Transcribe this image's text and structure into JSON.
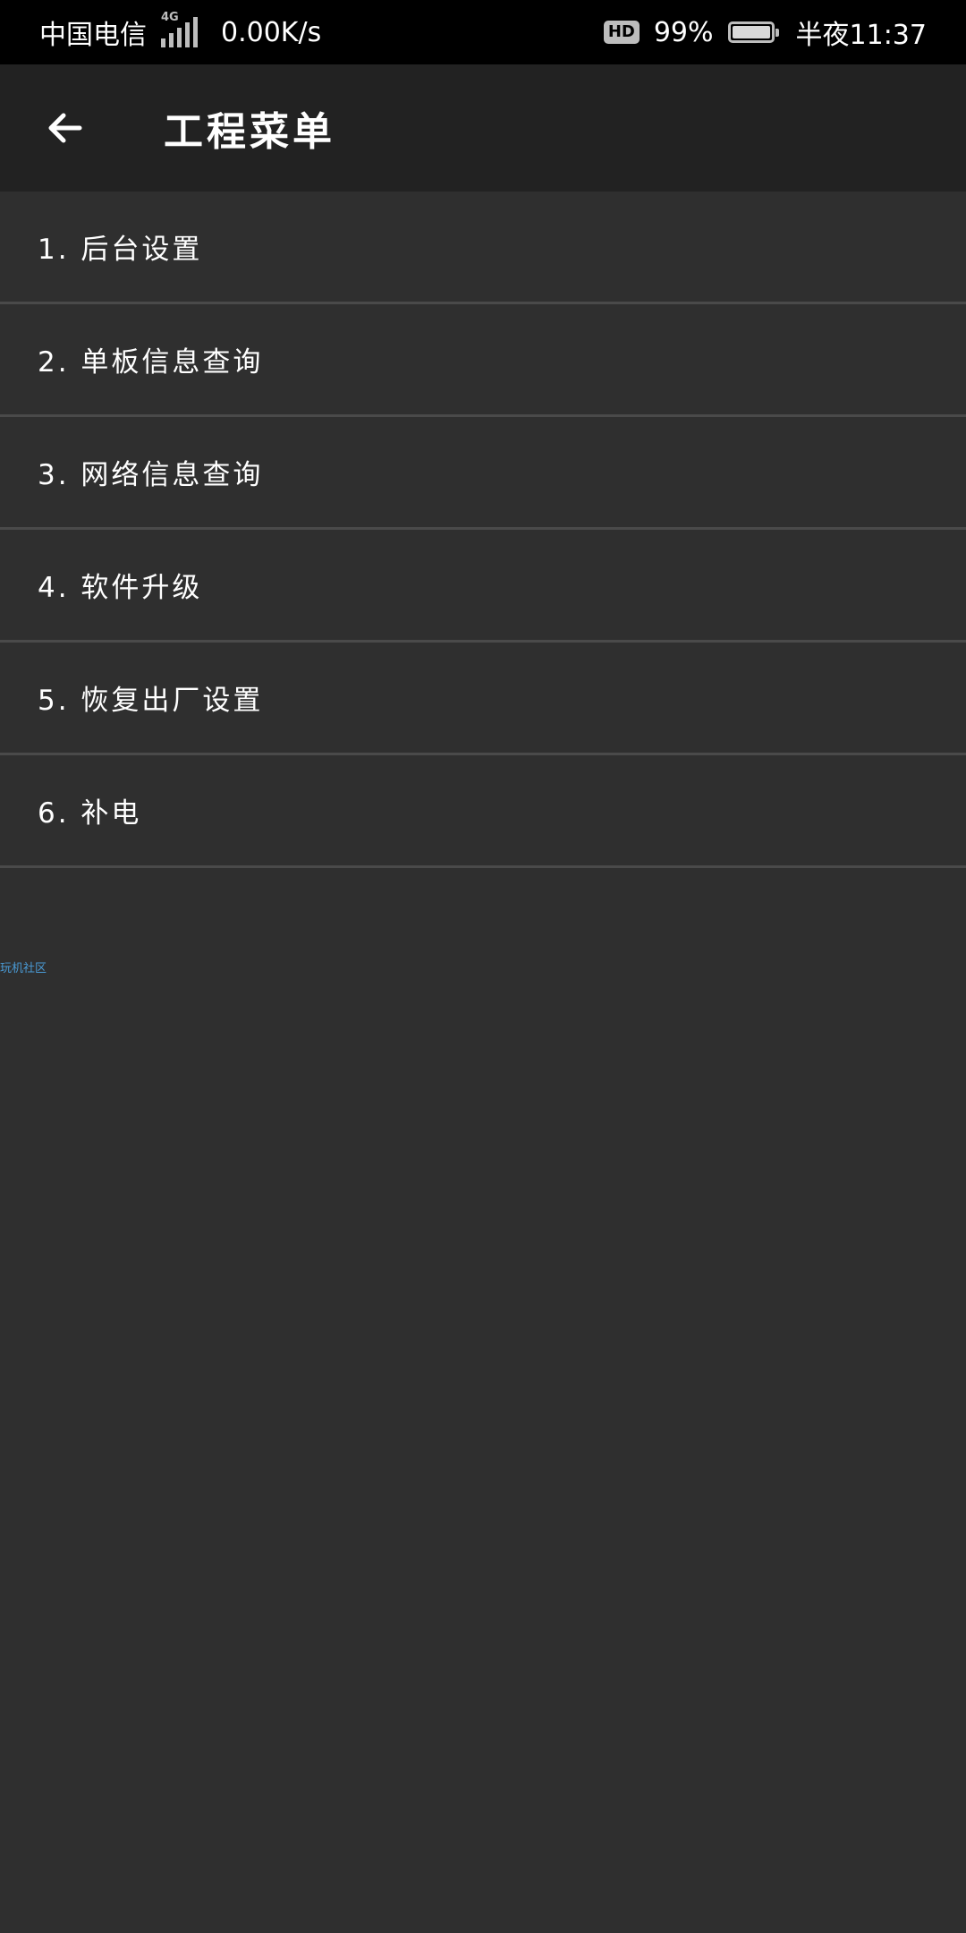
{
  "status_bar": {
    "carrier": "中国电信",
    "network_type": "4G",
    "speed": "0.00K/s",
    "hd": "HD",
    "battery_percent": "99%",
    "battery_level": 0.99,
    "time": "半夜11:37"
  },
  "header": {
    "title": "工程菜单",
    "back_icon": "arrow-left-icon"
  },
  "menu": {
    "items": [
      {
        "label": "1. 后台设置"
      },
      {
        "label": "2. 单板信息查询"
      },
      {
        "label": "3. 网络信息查询"
      },
      {
        "label": "4. 软件升级"
      },
      {
        "label": "5. 恢复出厂设置"
      },
      {
        "label": "6. 补电"
      }
    ]
  },
  "watermark": "玩机社区",
  "colors": {
    "status_bar_bg": "#000000",
    "app_bar_bg": "#222222",
    "content_bg": "#2f2f2f",
    "divider": "#4a4a4a",
    "watermark": "#4a9bd6"
  }
}
